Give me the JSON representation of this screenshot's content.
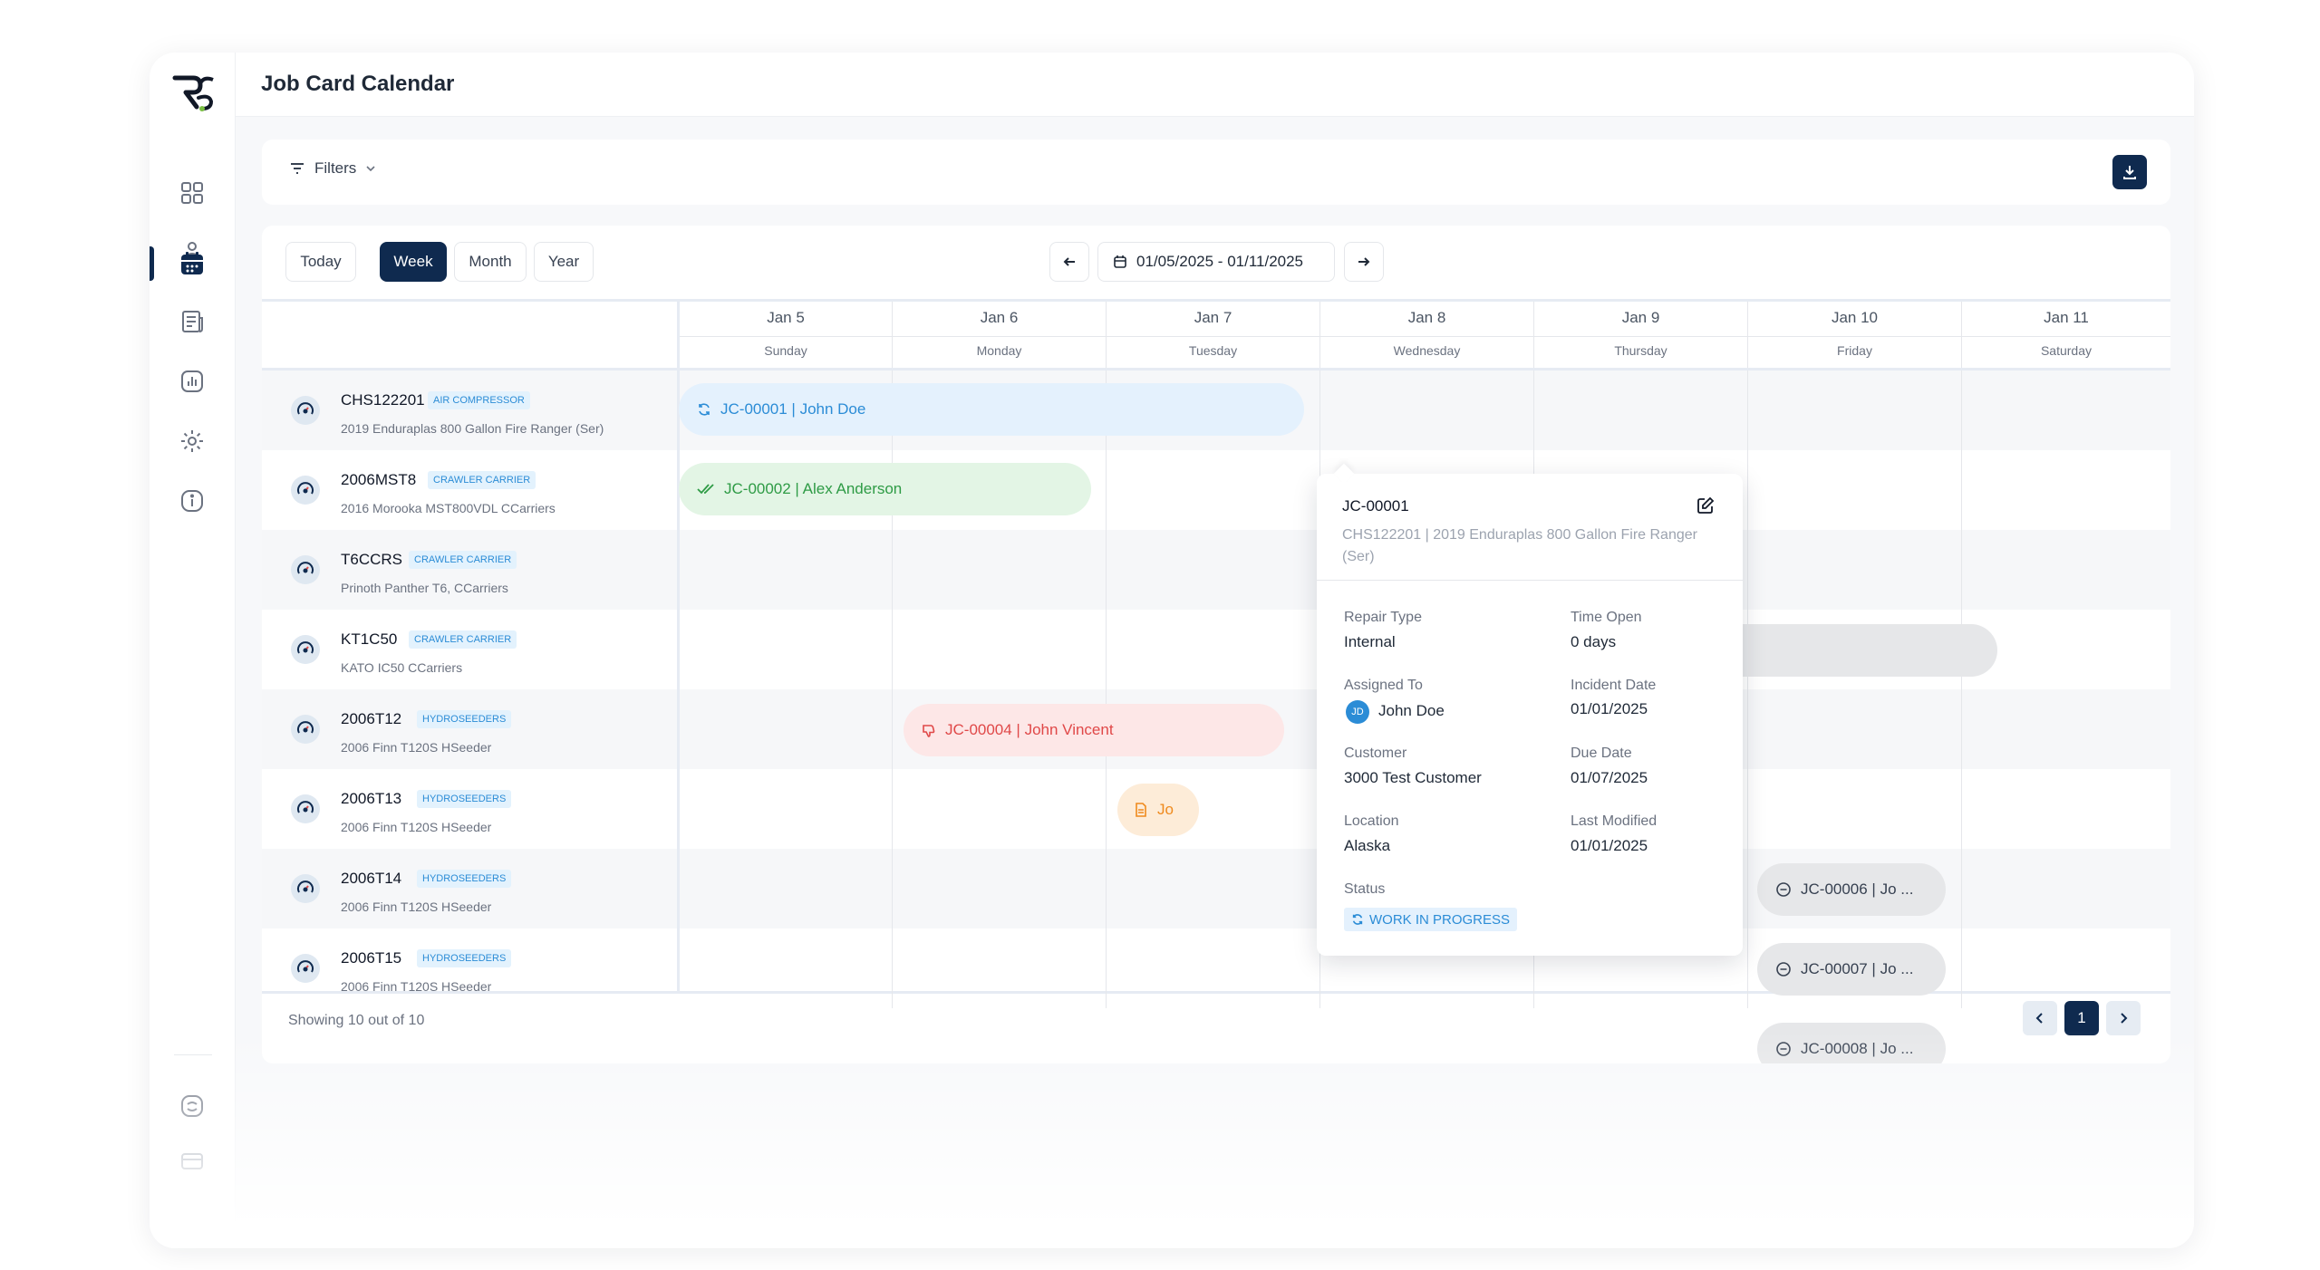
{
  "header": {
    "title": "Job Card Calendar"
  },
  "sidebar": {
    "items": [
      {
        "icon": "dashboard-grid-icon"
      },
      {
        "icon": "users-hierarchy-icon"
      },
      {
        "icon": "calendar-icon",
        "active": true
      },
      {
        "icon": "document-icon"
      },
      {
        "icon": "report-chart-icon"
      },
      {
        "icon": "settings-gear-icon"
      },
      {
        "icon": "info-icon"
      }
    ],
    "bottom_items": [
      {
        "icon": "support-icon"
      },
      {
        "icon": "message-icon"
      }
    ]
  },
  "filters": {
    "label": "Filters",
    "download_icon": "download-icon"
  },
  "toolbar": {
    "views": [
      "Today",
      "Week",
      "Month",
      "Year"
    ],
    "active_view": "Week",
    "date_range": "01/05/2025 - 01/11/2025"
  },
  "days": [
    {
      "date": "Jan 5",
      "name": "Sunday"
    },
    {
      "date": "Jan 6",
      "name": "Monday"
    },
    {
      "date": "Jan 7",
      "name": "Tuesday"
    },
    {
      "date": "Jan 8",
      "name": "Wednesday"
    },
    {
      "date": "Jan 9",
      "name": "Thursday"
    },
    {
      "date": "Jan 10",
      "name": "Friday"
    },
    {
      "date": "Jan 11",
      "name": "Saturday"
    }
  ],
  "resources": [
    {
      "name": "CHS122201",
      "badge": "AIR COMPRESSOR",
      "sub": "2019 Enduraplas 800 Gallon Fire Ranger (Ser)"
    },
    {
      "name": "2006MST8",
      "badge": "CRAWLER CARRIER",
      "sub": "2016 Morooka MST800VDL CCarriers"
    },
    {
      "name": "T6CCRS",
      "badge": "CRAWLER CARRIER",
      "sub": "Prinoth Panther T6, CCarriers"
    },
    {
      "name": "KT1C50",
      "badge": "CRAWLER CARRIER",
      "sub": "KATO IC50 CCarriers"
    },
    {
      "name": "2006T12",
      "badge": "HYDROSEEDERS",
      "sub": "2006 Finn T120S HSeeder"
    },
    {
      "name": "2006T13",
      "badge": "HYDROSEEDERS",
      "sub": "2006 Finn T120S HSeeder"
    },
    {
      "name": "2006T14",
      "badge": "HYDROSEEDERS",
      "sub": "2006 Finn T120S HSeeder"
    },
    {
      "name": "2006T15",
      "badge": "HYDROSEEDERS",
      "sub": "2006 Finn T120S HSeeder"
    }
  ],
  "events": [
    {
      "label": "JC-00001 | John Doe",
      "color": "blue",
      "icon": "sync-icon"
    },
    {
      "label": "JC-00002 | Alex Anderson",
      "color": "green",
      "icon": "double-check-icon"
    },
    {
      "label": "",
      "color": "gray",
      "icon": ""
    },
    {
      "label": "JC-00004 | John Vincent",
      "color": "red",
      "icon": "thumbs-down-icon"
    },
    {
      "label": "Jo",
      "color": "orange",
      "icon": "document-icon"
    },
    {
      "label": "JC-00006 | Jo ...",
      "color": "gray",
      "icon": "minus-circle-icon"
    },
    {
      "label": "JC-00007 | Jo ...",
      "color": "gray",
      "icon": "minus-circle-icon"
    },
    {
      "label": "JC-00008 | Jo ...",
      "color": "gray",
      "icon": "minus-circle-icon"
    }
  ],
  "footer": {
    "showing": "Showing 10 out of 10",
    "page": "1"
  },
  "popover": {
    "title": "JC-00001",
    "subtitle": "CHS122201 | 2019 Enduraplas 800 Gallon Fire Ranger (Ser)",
    "repair_type_label": "Repair Type",
    "repair_type": "Internal",
    "time_open_label": "Time Open",
    "time_open": "0 days",
    "assigned_label": "Assigned To",
    "assigned": "John Doe",
    "assigned_initials": "JD",
    "incident_label": "Incident Date",
    "incident": "01/01/2025",
    "customer_label": "Customer",
    "customer": "3000 Test Customer",
    "due_label": "Due Date",
    "due": "01/07/2025",
    "location_label": "Location",
    "location": "Alaska",
    "modified_label": "Last Modified",
    "modified": "01/01/2025",
    "status_label": "Status",
    "status": "WORK IN PROGRESS"
  },
  "colors": {
    "primary": "#0f2a4f",
    "accent_blue": "#2b8cd6",
    "green": "#2e9b45",
    "red": "#e04848",
    "orange": "#ef8a1d"
  }
}
